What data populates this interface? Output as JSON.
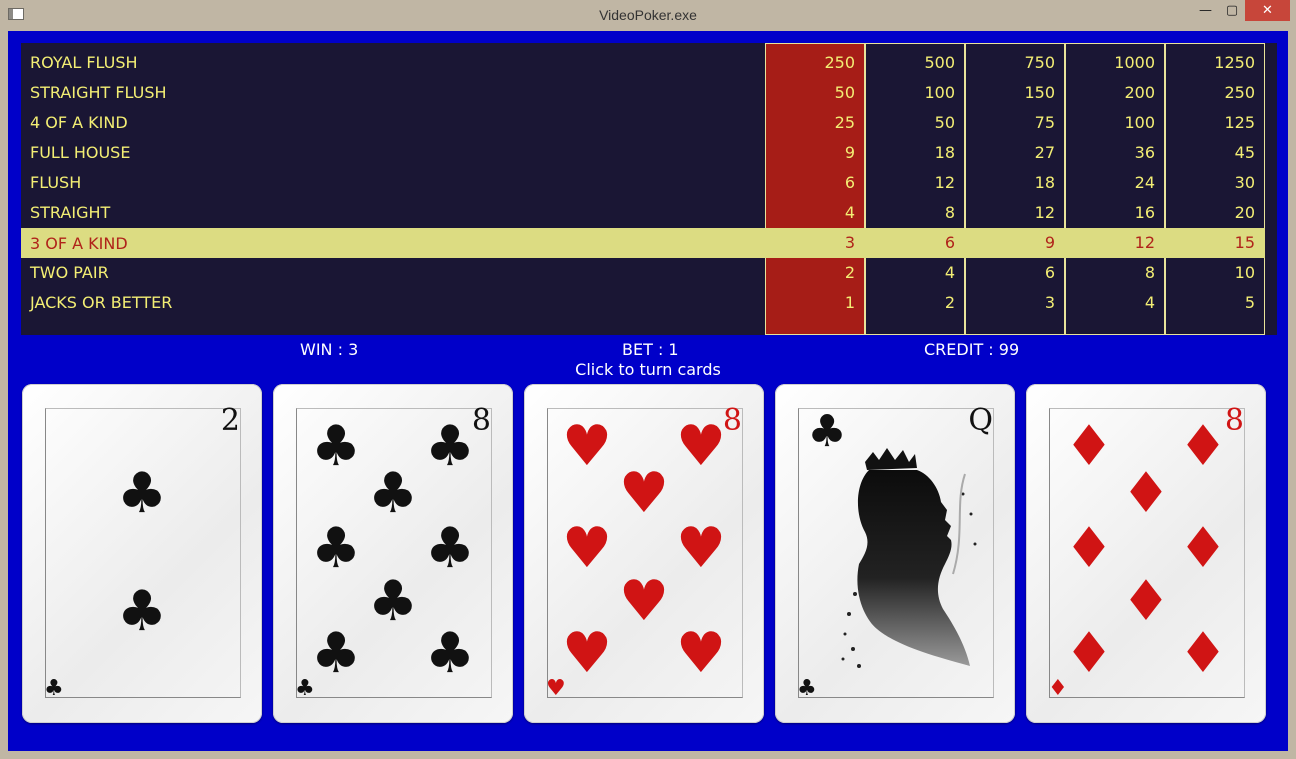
{
  "window": {
    "title": "VideoPoker.exe",
    "minimize_glyph": "—",
    "maximize_glyph": "▢",
    "close_glyph": "✕"
  },
  "paytable": {
    "hands": [
      "ROYAL FLUSH",
      "STRAIGHT FLUSH",
      "4 OF A KIND",
      "FULL HOUSE",
      "FLUSH",
      "STRAIGHT",
      "3 OF A KIND",
      "TWO PAIR",
      "JACKS OR BETTER"
    ],
    "highlighted_hand_index": 6,
    "selected_bet_column": 0,
    "columns": [
      [
        "250",
        "50",
        "25",
        "9",
        "6",
        "4",
        "3",
        "2",
        "1"
      ],
      [
        "500",
        "100",
        "50",
        "18",
        "12",
        "8",
        "6",
        "4",
        "2"
      ],
      [
        "750",
        "150",
        "75",
        "27",
        "18",
        "12",
        "9",
        "6",
        "3"
      ],
      [
        "1000",
        "200",
        "100",
        "36",
        "24",
        "16",
        "12",
        "8",
        "4"
      ],
      [
        "1250",
        "250",
        "125",
        "45",
        "30",
        "20",
        "15",
        "10",
        "5"
      ]
    ]
  },
  "status": {
    "win": "WIN : 3",
    "bet": "BET : 1",
    "credit": "CREDIT : 99",
    "hint": "Click to turn cards"
  },
  "cards": [
    {
      "rank": "2",
      "suit": "clubs",
      "glyph": "♣",
      "color": "black"
    },
    {
      "rank": "8",
      "suit": "clubs",
      "glyph": "♣",
      "color": "black"
    },
    {
      "rank": "8",
      "suit": "hearts",
      "glyph": "♥",
      "color": "red"
    },
    {
      "rank": "Q",
      "suit": "clubs",
      "glyph": "♣",
      "color": "black"
    },
    {
      "rank": "8",
      "suit": "diamonds",
      "glyph": "♦",
      "color": "red"
    }
  ],
  "colors": {
    "background": "#0000c9",
    "paytable_bg": "#1a1634",
    "text_yellow": "#f3ee74",
    "highlight_row": "#dcdc82",
    "selected_column": "#a61d17"
  }
}
